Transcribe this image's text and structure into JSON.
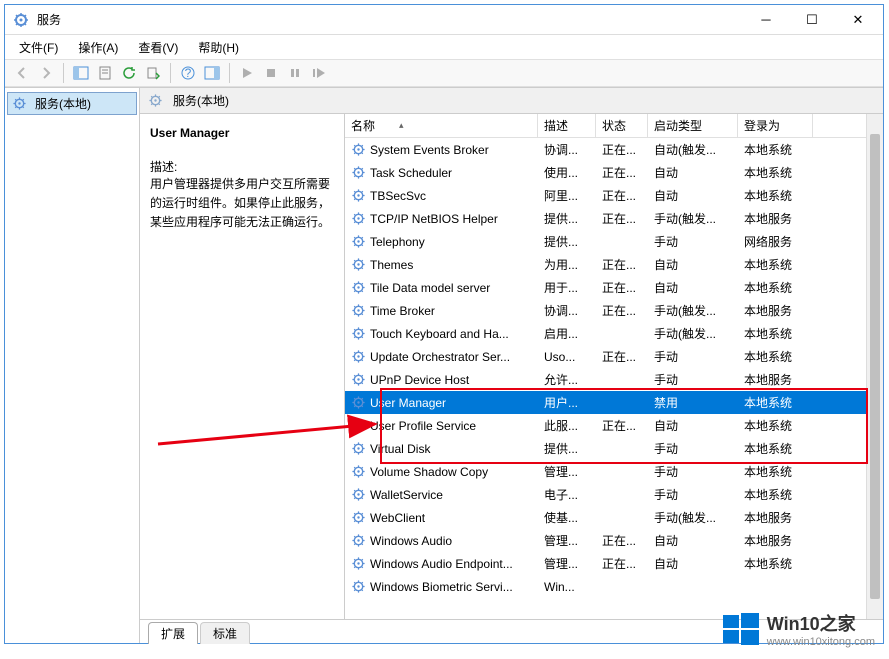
{
  "window": {
    "title": "服务"
  },
  "menu": {
    "file": "文件(F)",
    "action": "操作(A)",
    "view": "查看(V)",
    "help": "帮助(H)"
  },
  "tree": {
    "root": "服务(本地)"
  },
  "right_header": {
    "title": "服务(本地)"
  },
  "detail": {
    "title": "User Manager",
    "desc_label": "描述:",
    "desc_text": "用户管理器提供多用户交互所需要的运行时组件。如果停止此服务，某些应用程序可能无法正确运行。"
  },
  "columns": {
    "name": "名称",
    "desc": "描述",
    "status": "状态",
    "start": "启动类型",
    "logon": "登录为"
  },
  "rows": [
    {
      "name": "System Events Broker",
      "desc": "协调...",
      "status": "正在...",
      "start": "自动(触发...",
      "logon": "本地系统"
    },
    {
      "name": "Task Scheduler",
      "desc": "使用...",
      "status": "正在...",
      "start": "自动",
      "logon": "本地系统"
    },
    {
      "name": "TBSecSvc",
      "desc": "阿里...",
      "status": "正在...",
      "start": "自动",
      "logon": "本地系统"
    },
    {
      "name": "TCP/IP NetBIOS Helper",
      "desc": "提供...",
      "status": "正在...",
      "start": "手动(触发...",
      "logon": "本地服务"
    },
    {
      "name": "Telephony",
      "desc": "提供...",
      "status": "",
      "start": "手动",
      "logon": "网络服务"
    },
    {
      "name": "Themes",
      "desc": "为用...",
      "status": "正在...",
      "start": "自动",
      "logon": "本地系统"
    },
    {
      "name": "Tile Data model server",
      "desc": "用于...",
      "status": "正在...",
      "start": "自动",
      "logon": "本地系统"
    },
    {
      "name": "Time Broker",
      "desc": "协调...",
      "status": "正在...",
      "start": "手动(触发...",
      "logon": "本地服务"
    },
    {
      "name": "Touch Keyboard and Ha...",
      "desc": "启用...",
      "status": "",
      "start": "手动(触发...",
      "logon": "本地系统"
    },
    {
      "name": "Update Orchestrator Ser...",
      "desc": "Uso...",
      "status": "正在...",
      "start": "手动",
      "logon": "本地系统"
    },
    {
      "name": "UPnP Device Host",
      "desc": "允许...",
      "status": "",
      "start": "手动",
      "logon": "本地服务"
    },
    {
      "name": "User Manager",
      "desc": "用户...",
      "status": "",
      "start": "禁用",
      "logon": "本地系统",
      "selected": true
    },
    {
      "name": "User Profile Service",
      "desc": "此服...",
      "status": "正在...",
      "start": "自动",
      "logon": "本地系统"
    },
    {
      "name": "Virtual Disk",
      "desc": "提供...",
      "status": "",
      "start": "手动",
      "logon": "本地系统"
    },
    {
      "name": "Volume Shadow Copy",
      "desc": "管理...",
      "status": "",
      "start": "手动",
      "logon": "本地系统"
    },
    {
      "name": "WalletService",
      "desc": "电子...",
      "status": "",
      "start": "手动",
      "logon": "本地系统"
    },
    {
      "name": "WebClient",
      "desc": "使基...",
      "status": "",
      "start": "手动(触发...",
      "logon": "本地服务"
    },
    {
      "name": "Windows Audio",
      "desc": "管理...",
      "status": "正在...",
      "start": "自动",
      "logon": "本地服务"
    },
    {
      "name": "Windows Audio Endpoint...",
      "desc": "管理...",
      "status": "正在...",
      "start": "自动",
      "logon": "本地系统"
    },
    {
      "name": "Windows Biometric Servi...",
      "desc": "Win...",
      "status": "",
      "start": "",
      "logon": ""
    }
  ],
  "tabs": {
    "extended": "扩展",
    "standard": "标准"
  },
  "watermark": {
    "title": "Win10之家",
    "url": "www.win10xitong.com"
  }
}
